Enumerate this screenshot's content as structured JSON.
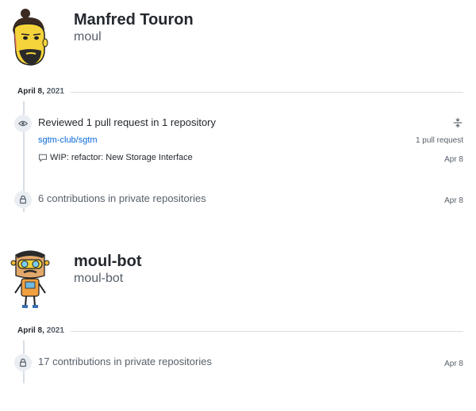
{
  "users": [
    {
      "name": "Manfred Touron",
      "login": "moul",
      "date_label": "April 8,",
      "date_year": "2021",
      "reviewed": {
        "title": "Reviewed 1 pull request in 1 repository",
        "repo": "sgtm-club/sgtm",
        "repo_meta": "1 pull request",
        "pr_title": "WIP: refactor: New Storage Interface",
        "pr_date": "Apr 8"
      },
      "private": {
        "text": "6 contributions in private repositories",
        "date": "Apr 8"
      }
    },
    {
      "name": "moul-bot",
      "login": "moul-bot",
      "date_label": "April 8,",
      "date_year": "2021",
      "private": {
        "text": "17 contributions in private repositories",
        "date": "Apr 8"
      }
    }
  ],
  "icons": {
    "review": "eye-icon",
    "private": "lock-icon",
    "comment": "comment-icon",
    "fold": "fold-icon"
  },
  "colors": {
    "link": "#0969da",
    "muted": "#57606a",
    "border": "#d8dee4",
    "badge_bg": "#eaeef2"
  }
}
